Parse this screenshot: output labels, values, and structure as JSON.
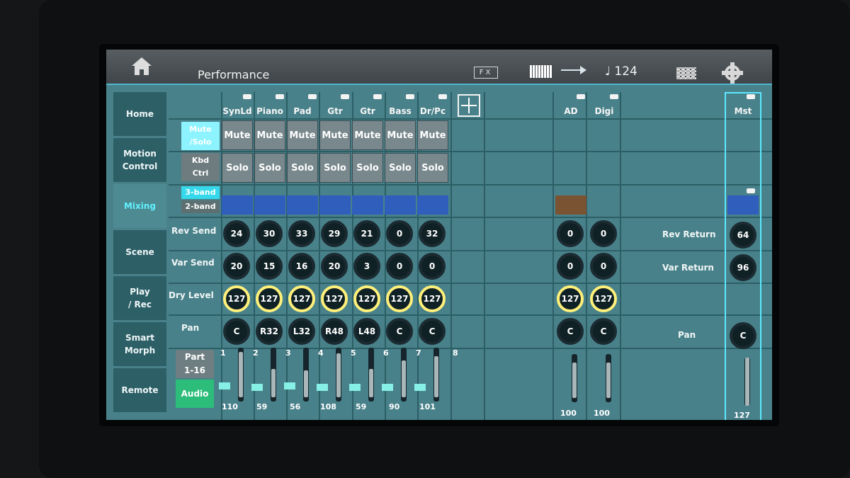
{
  "topbar": {
    "title": "Performance",
    "fx": "FX",
    "tempo": "♩ 124"
  },
  "sidebar": [
    {
      "label": "Home",
      "active": false
    },
    {
      "label": "Motion\nControl",
      "active": false
    },
    {
      "label": "Mixing",
      "active": true
    },
    {
      "label": "Scene",
      "active": false
    },
    {
      "label": "Play\n/ Rec",
      "active": false
    },
    {
      "label": "Smart\nMorph",
      "active": false
    },
    {
      "label": "Remote",
      "active": false
    }
  ],
  "buttons": {
    "mute_solo": "Mute\n/Solo",
    "kbd_ctrl": "Kbd\nCtrl",
    "band3": "3-band",
    "band2": "2-band",
    "part": "Part\n1-16",
    "audio": "Audio",
    "mute": "Mute",
    "solo": "Solo"
  },
  "row_labels": {
    "rev": "Rev Send",
    "var": "Var Send",
    "dry": "Dry Level",
    "pan": "Pan"
  },
  "parts": [
    {
      "name": "SynLd",
      "num": "1",
      "rev": "24",
      "var": "20",
      "dry": "127",
      "pan": "C",
      "vol": "110"
    },
    {
      "name": "Piano",
      "num": "2",
      "rev": "30",
      "var": "15",
      "dry": "127",
      "pan": "R32",
      "vol": "59"
    },
    {
      "name": "Pad",
      "num": "3",
      "rev": "33",
      "var": "16",
      "dry": "127",
      "pan": "L32",
      "vol": "56"
    },
    {
      "name": "Gtr",
      "num": "4",
      "rev": "29",
      "var": "20",
      "dry": "127",
      "pan": "R48",
      "vol": "108"
    },
    {
      "name": "Gtr",
      "num": "5",
      "rev": "21",
      "var": "3",
      "dry": "127",
      "pan": "L48",
      "vol": "59"
    },
    {
      "name": "Bass",
      "num": "6",
      "rev": "0",
      "var": "0",
      "dry": "127",
      "pan": "C",
      "vol": "90"
    },
    {
      "name": "Dr/Pc",
      "num": "7",
      "rev": "32",
      "var": "0",
      "dry": "127",
      "pan": "C",
      "vol": "101"
    }
  ],
  "part8": "8",
  "audio": [
    {
      "name": "AD",
      "rev": "0",
      "var": "0",
      "dry": "127",
      "pan": "C",
      "vol": "100"
    },
    {
      "name": "Digi",
      "rev": "0",
      "var": "0",
      "dry": "127",
      "pan": "C",
      "vol": "100"
    }
  ],
  "master": {
    "name": "Mst",
    "rev_return": "64",
    "var_return": "96",
    "pan": "C",
    "vol": "127",
    "rev_label": "Rev Return",
    "var_label": "Var Return",
    "pan_label": "Pan"
  }
}
